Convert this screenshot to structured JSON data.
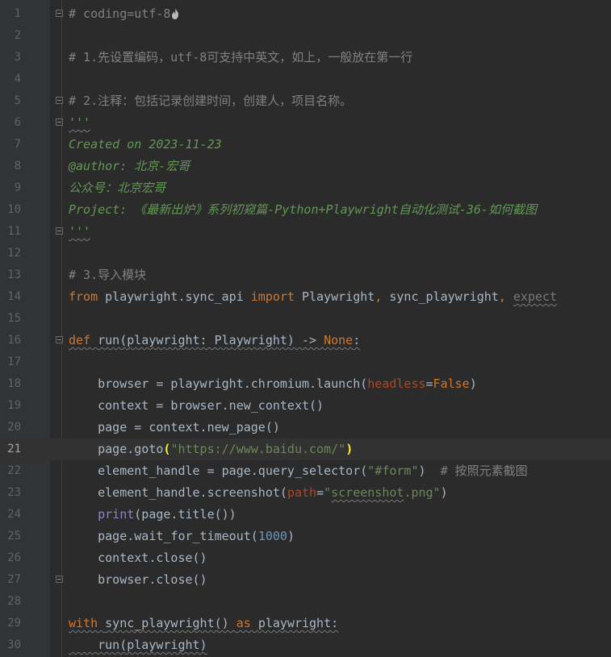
{
  "editor": {
    "current_line": 21,
    "lines": [
      {
        "n": "1",
        "fold": "open",
        "segs": [
          {
            "c": "c-comment",
            "t": "# coding=utf-8"
          }
        ],
        "icon": "flame-icon"
      },
      {
        "n": "2",
        "segs": []
      },
      {
        "n": "3",
        "segs": [
          {
            "c": "c-comment",
            "t": "# 1.先设置编码，utf-8可支持中英文，如上，一般放在第一行"
          }
        ]
      },
      {
        "n": "4",
        "segs": []
      },
      {
        "n": "5",
        "fold": "open",
        "segs": [
          {
            "c": "c-comment",
            "t": "# 2.注释：包括记录创建时间，创建人，项目名称。"
          }
        ]
      },
      {
        "n": "6",
        "fold": "open",
        "segs": [
          {
            "c": "c-doc wavy",
            "t": "'''"
          }
        ]
      },
      {
        "n": "7",
        "segs": [
          {
            "c": "c-doc",
            "t": "Created on 2023-11-23"
          }
        ]
      },
      {
        "n": "8",
        "segs": [
          {
            "c": "c-doc",
            "t": "@author: 北京-宏哥"
          }
        ]
      },
      {
        "n": "9",
        "segs": [
          {
            "c": "c-doc",
            "t": "公众号：北京宏哥"
          }
        ]
      },
      {
        "n": "10",
        "segs": [
          {
            "c": "c-doc",
            "t": "Project: 《最新出炉》系列初窥篇-Python+Playwright自动化测试-36-如何截图"
          }
        ]
      },
      {
        "n": "11",
        "fold": "close",
        "segs": [
          {
            "c": "c-doc wavy",
            "t": "'''"
          }
        ]
      },
      {
        "n": "12",
        "segs": []
      },
      {
        "n": "13",
        "segs": [
          {
            "c": "c-comment",
            "t": "# 3.导入模块"
          }
        ]
      },
      {
        "n": "14",
        "segs": [
          {
            "c": "c-kw",
            "t": "from "
          },
          {
            "c": "c-plain",
            "t": "playwright.sync_api "
          },
          {
            "c": "c-kw",
            "t": "import "
          },
          {
            "c": "c-plain",
            "t": "Playwright"
          },
          {
            "c": "c-kw",
            "t": ", "
          },
          {
            "c": "c-plain",
            "t": "sync_playwright"
          },
          {
            "c": "c-kw",
            "t": ", "
          },
          {
            "c": "c-dim wavy",
            "t": "expect"
          }
        ]
      },
      {
        "n": "15",
        "segs": []
      },
      {
        "n": "16",
        "fold": "open",
        "segs": [
          {
            "c": "c-kw wavy",
            "t": "def "
          },
          {
            "c": "c-plain wavy",
            "t": "run(playwright: Playwright) -> "
          },
          {
            "c": "c-kw wavy",
            "t": "None"
          },
          {
            "c": "c-plain wavy",
            "t": ":"
          }
        ]
      },
      {
        "n": "17",
        "segs": []
      },
      {
        "n": "18",
        "segs": [
          {
            "c": "c-plain",
            "t": "    browser = playwright.chromium.launch("
          },
          {
            "c": "c-param",
            "t": "headless"
          },
          {
            "c": "c-plain",
            "t": "="
          },
          {
            "c": "c-kw",
            "t": "False"
          },
          {
            "c": "c-plain",
            "t": ")"
          }
        ]
      },
      {
        "n": "19",
        "segs": [
          {
            "c": "c-plain",
            "t": "    context = browser.new_context()"
          }
        ]
      },
      {
        "n": "20",
        "segs": [
          {
            "c": "c-plain",
            "t": "    page = context.new_page()"
          }
        ]
      },
      {
        "n": "21",
        "segs": [
          {
            "c": "c-plain",
            "t": "    page.goto"
          },
          {
            "c": "brace",
            "t": "("
          },
          {
            "c": "c-str",
            "t": "\"https://www.baidu.com/\""
          },
          {
            "c": "brace",
            "t": ")"
          }
        ]
      },
      {
        "n": "22",
        "segs": [
          {
            "c": "c-plain",
            "t": "    element_handle = page.query_selector("
          },
          {
            "c": "c-str",
            "t": "\"#form\""
          },
          {
            "c": "c-plain",
            "t": ")  "
          },
          {
            "c": "c-comment",
            "t": "# 按照元素截图"
          }
        ]
      },
      {
        "n": "23",
        "segs": [
          {
            "c": "c-plain",
            "t": "    element_handle.screenshot("
          },
          {
            "c": "c-param",
            "t": "path"
          },
          {
            "c": "c-plain",
            "t": "="
          },
          {
            "c": "c-str",
            "t": "\""
          },
          {
            "c": "c-str wavy",
            "t": "screenshot"
          },
          {
            "c": "c-str",
            "t": ".png\""
          },
          {
            "c": "c-plain",
            "t": ")"
          }
        ]
      },
      {
        "n": "24",
        "segs": [
          {
            "c": "c-builtin",
            "t": "    print"
          },
          {
            "c": "c-plain",
            "t": "(page.title())"
          }
        ]
      },
      {
        "n": "25",
        "segs": [
          {
            "c": "c-plain",
            "t": "    page.wait_for_timeout("
          },
          {
            "c": "c-num",
            "t": "1000"
          },
          {
            "c": "c-plain",
            "t": ")"
          }
        ]
      },
      {
        "n": "26",
        "segs": [
          {
            "c": "c-plain",
            "t": "    context.close()"
          }
        ]
      },
      {
        "n": "27",
        "fold": "close",
        "segs": [
          {
            "c": "c-plain",
            "t": "    browser.close()"
          }
        ]
      },
      {
        "n": "28",
        "segs": []
      },
      {
        "n": "29",
        "segs": [
          {
            "c": "c-kw wavy",
            "t": "with "
          },
          {
            "c": "c-plain wavy",
            "t": "sync_playwright() "
          },
          {
            "c": "c-kw wavy",
            "t": "as "
          },
          {
            "c": "c-plain wavy",
            "t": "playwright:"
          }
        ]
      },
      {
        "n": "30",
        "segs": [
          {
            "c": "c-plain wavy",
            "t": "    run(playwright)"
          }
        ]
      }
    ]
  },
  "colors": {
    "background": "#2b2b2b",
    "gutter": "#313335",
    "comment": "#808080",
    "docstring": "#629755",
    "keyword": "#cc7832",
    "string": "#6a8759",
    "number": "#6897bb",
    "builtin": "#8888c6",
    "param": "#aa4926",
    "text": "#a9b7c6",
    "current_line": "#323232",
    "brace_match": "#ffef28"
  }
}
